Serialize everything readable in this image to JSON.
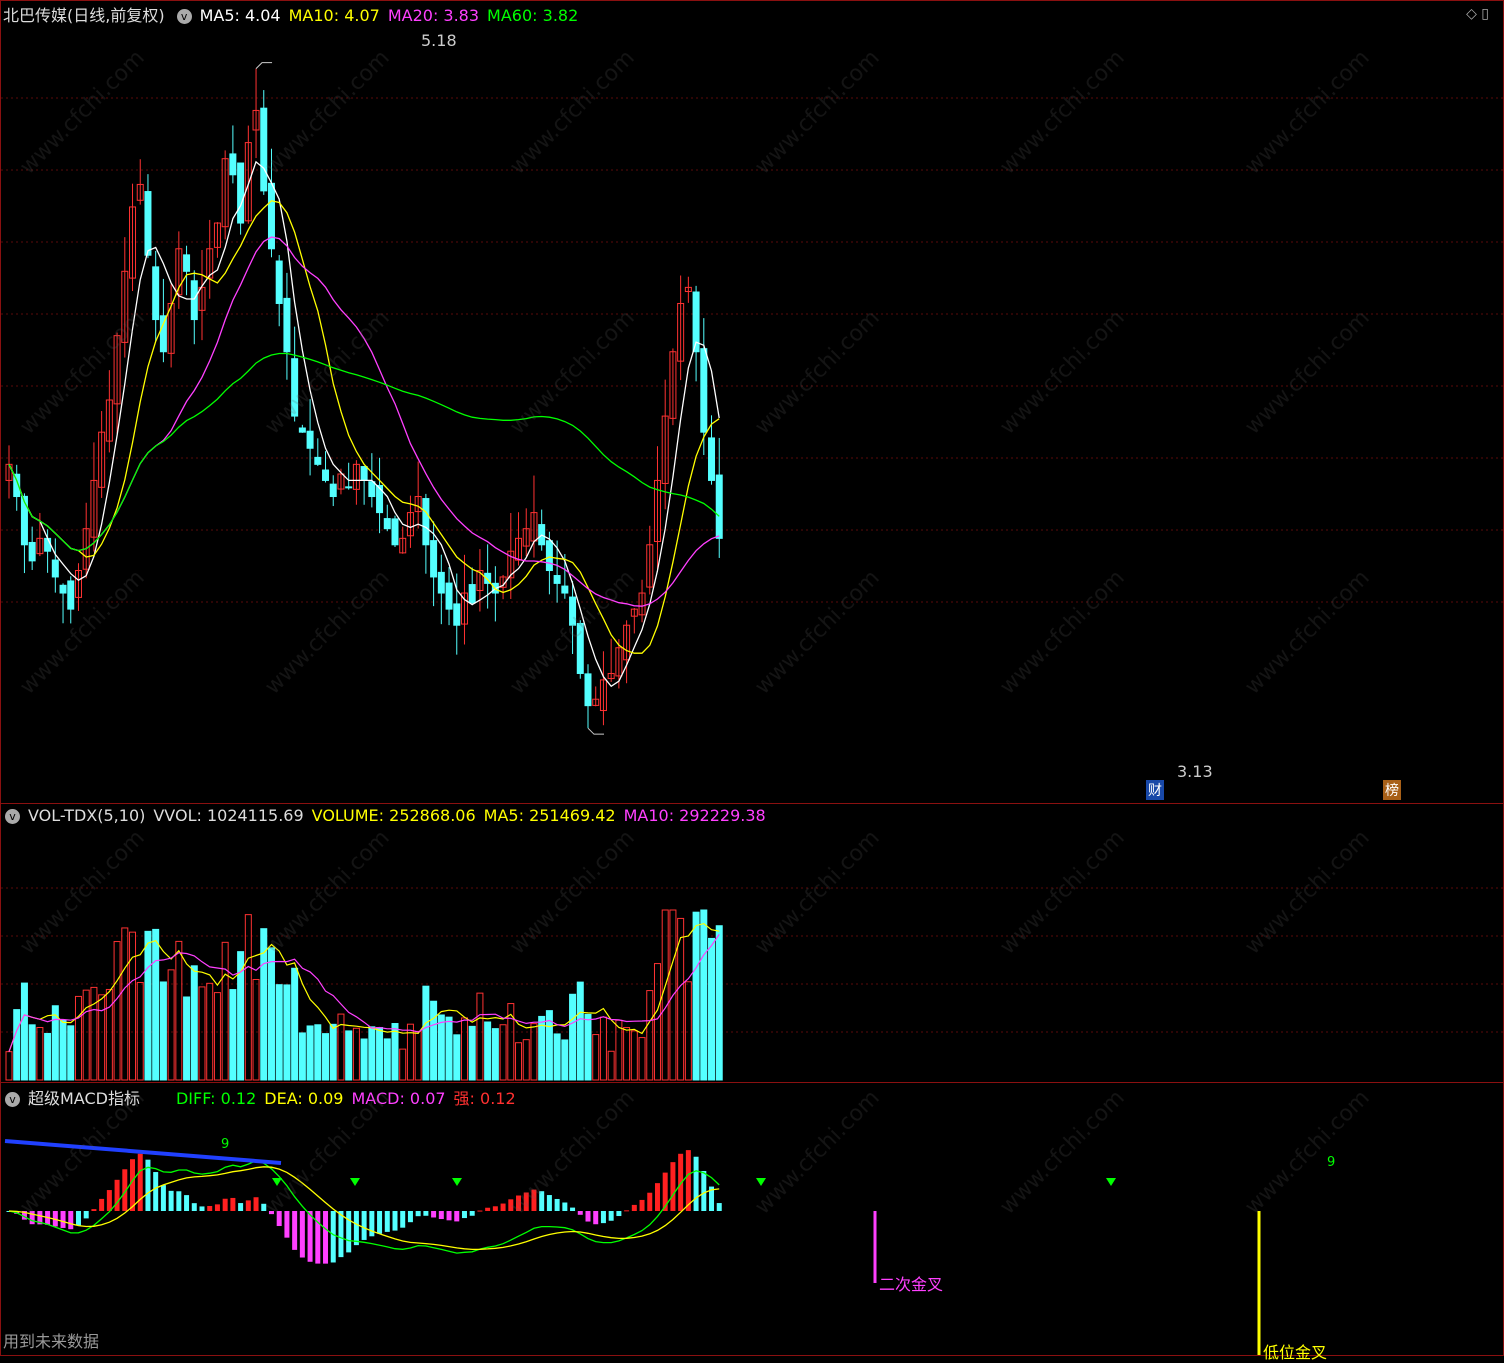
{
  "price_panel": {
    "stock_title": "北巴传媒(日线,前复权)",
    "indicators": [
      {
        "label": "MA5: 4.04",
        "color": "#ffffff"
      },
      {
        "label": "MA10: 4.07",
        "color": "#ffff00"
      },
      {
        "label": "MA20: 3.83",
        "color": "#ff40ff"
      },
      {
        "label": "MA60: 3.82",
        "color": "#00ff00"
      }
    ],
    "high_label": "5.18",
    "low_label": "3.13",
    "badge_cai": "财",
    "badge_bang": "榜",
    "corner_icons": "◇ ▯"
  },
  "vol_panel": {
    "title": "VOL-TDX(5,10)",
    "indicators": [
      {
        "label": "VVOL: 1024115.69",
        "color": "#dddddd"
      },
      {
        "label": "VOLUME: 252868.06",
        "color": "#ffff00"
      },
      {
        "label": "MA5: 251469.42",
        "color": "#ffff00"
      },
      {
        "label": "MA10: 292229.38",
        "color": "#ff40ff"
      }
    ]
  },
  "macd_panel": {
    "title": "超级MACD指标",
    "indicators": [
      {
        "label": "DIFF: 0.12",
        "color": "#00ff00"
      },
      {
        "label": "DEA: 0.09",
        "color": "#ffff00"
      },
      {
        "label": "MACD: 0.07",
        "color": "#ff40ff"
      },
      {
        "label": "强: 0.12",
        "color": "#ff3030"
      }
    ],
    "annotation_second_cross": "二次金叉",
    "annotation_low_cross": "低位金叉",
    "mark_9": "9"
  },
  "footer": "用到未来数据",
  "watermark": "www.cfchi.com",
  "chart_data": {
    "type": "candlestick",
    "price_range": [
      3.0,
      5.3
    ],
    "high": 5.18,
    "low": 3.13,
    "candles": [
      3.95,
      3.85,
      3.7,
      3.65,
      3.72,
      3.68,
      3.6,
      3.55,
      3.5,
      3.62,
      3.75,
      3.9,
      4.05,
      4.15,
      4.35,
      4.55,
      4.75,
      4.82,
      4.6,
      4.4,
      4.3,
      4.45,
      4.62,
      4.55,
      4.4,
      4.5,
      4.62,
      4.7,
      4.9,
      4.85,
      4.7,
      4.95,
      5.05,
      4.8,
      4.62,
      4.45,
      4.3,
      4.1,
      4.05,
      4.0,
      3.95,
      3.9,
      3.85,
      3.92,
      3.88,
      3.95,
      3.9,
      3.85,
      3.8,
      3.75,
      3.7,
      3.72,
      3.8,
      3.85,
      3.7,
      3.6,
      3.55,
      3.5,
      3.45,
      3.55,
      3.52,
      3.62,
      3.58,
      3.55,
      3.6,
      3.68,
      3.72,
      3.75,
      3.8,
      3.7,
      3.62,
      3.58,
      3.55,
      3.45,
      3.3,
      3.2,
      3.22,
      3.28,
      3.3,
      3.38,
      3.45,
      3.5,
      3.55,
      3.7,
      3.9,
      4.1,
      4.3,
      4.45,
      4.5,
      4.3,
      4.05,
      3.9,
      3.72
    ],
    "ma5_last": 4.04,
    "ma10_last": 4.07,
    "ma20_last": 3.83,
    "ma60_last": 3.82,
    "volume_last": 252868.06,
    "vol_ma5_last": 251469.42,
    "vol_ma10_last": 292229.38,
    "diff_last": 0.12,
    "dea_last": 0.09,
    "macd_last": 0.07
  }
}
